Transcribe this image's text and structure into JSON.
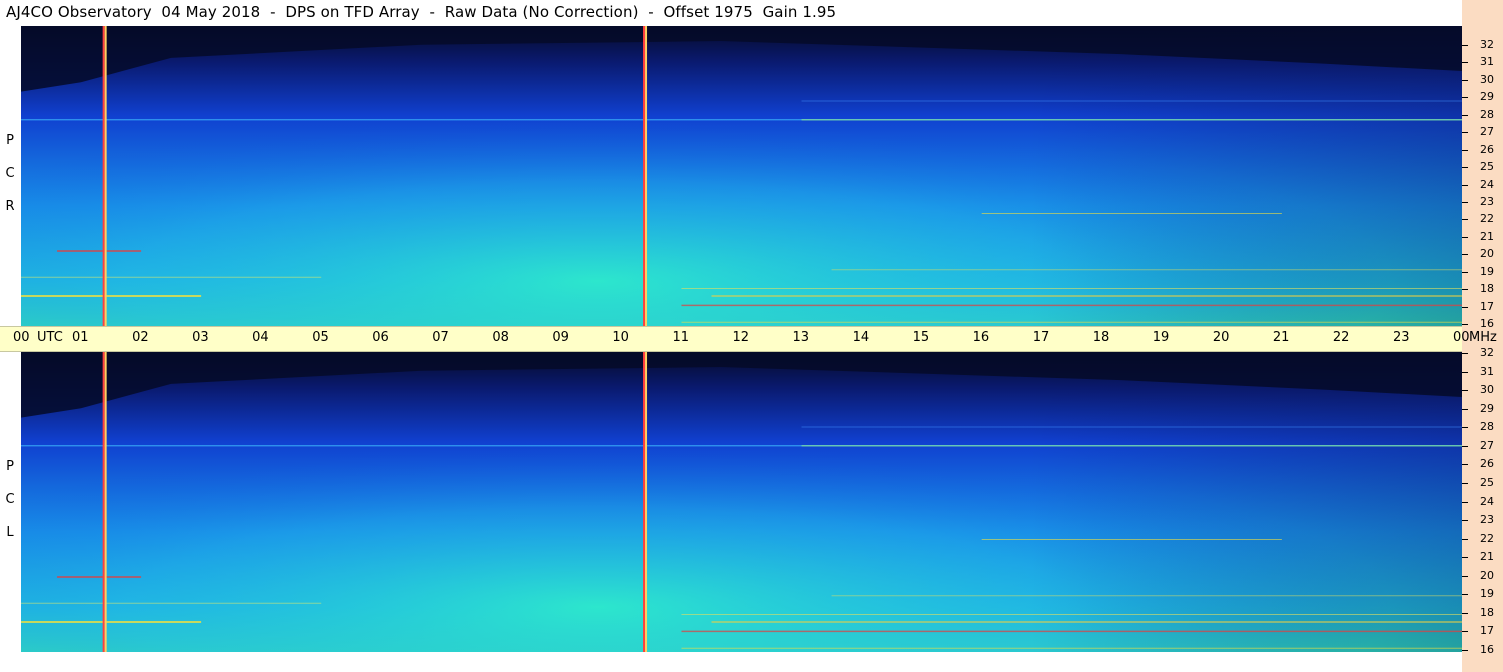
{
  "title": "AJ4CO Observatory  04 May 2018  -  DPS on TFD Array  -  Raw Data (No Correction)  -  Offset 1975  Gain 1.95",
  "panels": [
    {
      "id": "rcp",
      "letters": [
        "P",
        "C",
        "R"
      ]
    },
    {
      "id": "lcp",
      "letters": [
        "P",
        "C",
        "L"
      ]
    }
  ],
  "time_axis": {
    "labels": [
      "00",
      "UTC",
      "01",
      "02",
      "03",
      "04",
      "05",
      "06",
      "07",
      "08",
      "09",
      "10",
      "11",
      "12",
      "13",
      "14",
      "15",
      "16",
      "17",
      "18",
      "19",
      "20",
      "21",
      "22",
      "23",
      "00",
      "MHz"
    ]
  },
  "chart_data": {
    "type": "heatmap",
    "title": "AJ4CO Observatory  04 May 2018  -  DPS on TFD Array  -  Raw Data (No Correction)  -  Offset 1975  Gain 1.95",
    "xlabel": "UTC",
    "ylabel": "MHz",
    "x_range": [
      0,
      24
    ],
    "y_range": [
      16,
      32
    ],
    "y_ticks": [
      "32",
      "31",
      "30",
      "29",
      "28",
      "27",
      "26",
      "25",
      "24",
      "23",
      "22",
      "21",
      "20",
      "19",
      "18",
      "17",
      "16"
    ],
    "series": [
      {
        "name": "RCP",
        "description_values": "dynamic spectrum"
      },
      {
        "name": "LCP",
        "description_values": "dynamic spectrum"
      }
    ],
    "vertical_markers_utc": [
      1.4,
      10.4
    ],
    "colors": {
      "low": "#050a28",
      "mid": "#1060e0",
      "high": "#30e0c0",
      "peak": "#f02020"
    }
  }
}
